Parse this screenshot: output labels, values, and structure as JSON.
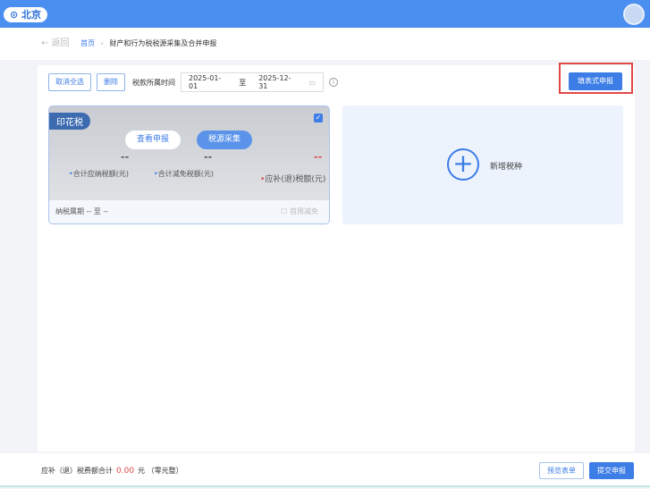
{
  "header": {
    "city": "北京"
  },
  "breadcrumb": {
    "back": "返回",
    "home": "首页",
    "sep": "›",
    "current": "财产和行为税税源采集及合并申报"
  },
  "toolbar": {
    "cancel_select": "取消全选",
    "delete": "删除",
    "period_label": "税款所属时间",
    "start_date": "2025-01-01",
    "to": "至",
    "end_date": "2025-12-31",
    "fill_form_declare": "填表式申报"
  },
  "card": {
    "tax_name": "印花税",
    "view_declare": "查看申报",
    "collect": "税源采集",
    "payable": "--",
    "payable_label": "合计应纳税额(元)",
    "reduction": "--",
    "reduction_label": "合计减免税额(元)",
    "refund": "--",
    "refund_label": "应补(退)税额(元)",
    "period": "纳税属期 -- 至 --",
    "exemption": "首用减免",
    "checked": true
  },
  "add_card": {
    "label": "新增税种"
  },
  "footer": {
    "total_label": "应补（退）税费额合计",
    "total_amount": "0.00",
    "unit": "元",
    "amount_caps": "（零元整）",
    "preview": "预览表单",
    "submit": "提交申报"
  },
  "colors": {
    "primary": "#3c7de6",
    "danger": "#e04848"
  }
}
